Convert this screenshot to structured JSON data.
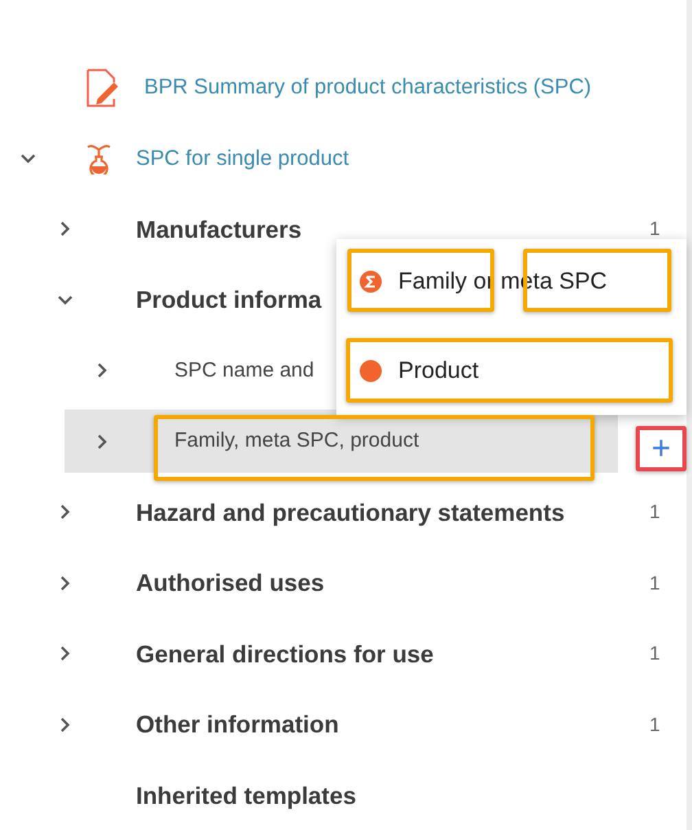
{
  "tree": [
    {
      "label": "BPR Summary of product characteristics (SPC)",
      "kind": "document-pencil",
      "selected": false
    },
    {
      "label": "SPC for single product",
      "kind": "flask",
      "selected": false,
      "expanded": true,
      "children": [
        {
          "label": "Manufacturers",
          "count": "1",
          "expanded": false,
          "selected": false
        },
        {
          "label": "Product informa",
          "expanded": true,
          "selected": false,
          "children": [
            {
              "label": "SPC name and",
              "expanded": false,
              "selected": false
            },
            {
              "label": "Family, meta SPC, product",
              "expanded": false,
              "selected": true
            }
          ]
        },
        {
          "label": "Hazard and precautionary statements",
          "count": "1",
          "expanded": false,
          "selected": false
        },
        {
          "label": "Authorised uses",
          "count": "1",
          "expanded": false,
          "selected": false
        },
        {
          "label": "General directions for use",
          "count": "1",
          "expanded": false,
          "selected": false
        },
        {
          "label": "Other information",
          "count": "1",
          "expanded": false,
          "selected": false
        },
        {
          "label": "Inherited templates",
          "selected": false
        }
      ]
    }
  ],
  "add_button": {
    "label": "+"
  },
  "popup_menu": [
    {
      "label": "Family or meta SPC",
      "kind": "sigma"
    },
    {
      "label": "Product",
      "kind": "dot",
      "color": "#f06430"
    }
  ]
}
